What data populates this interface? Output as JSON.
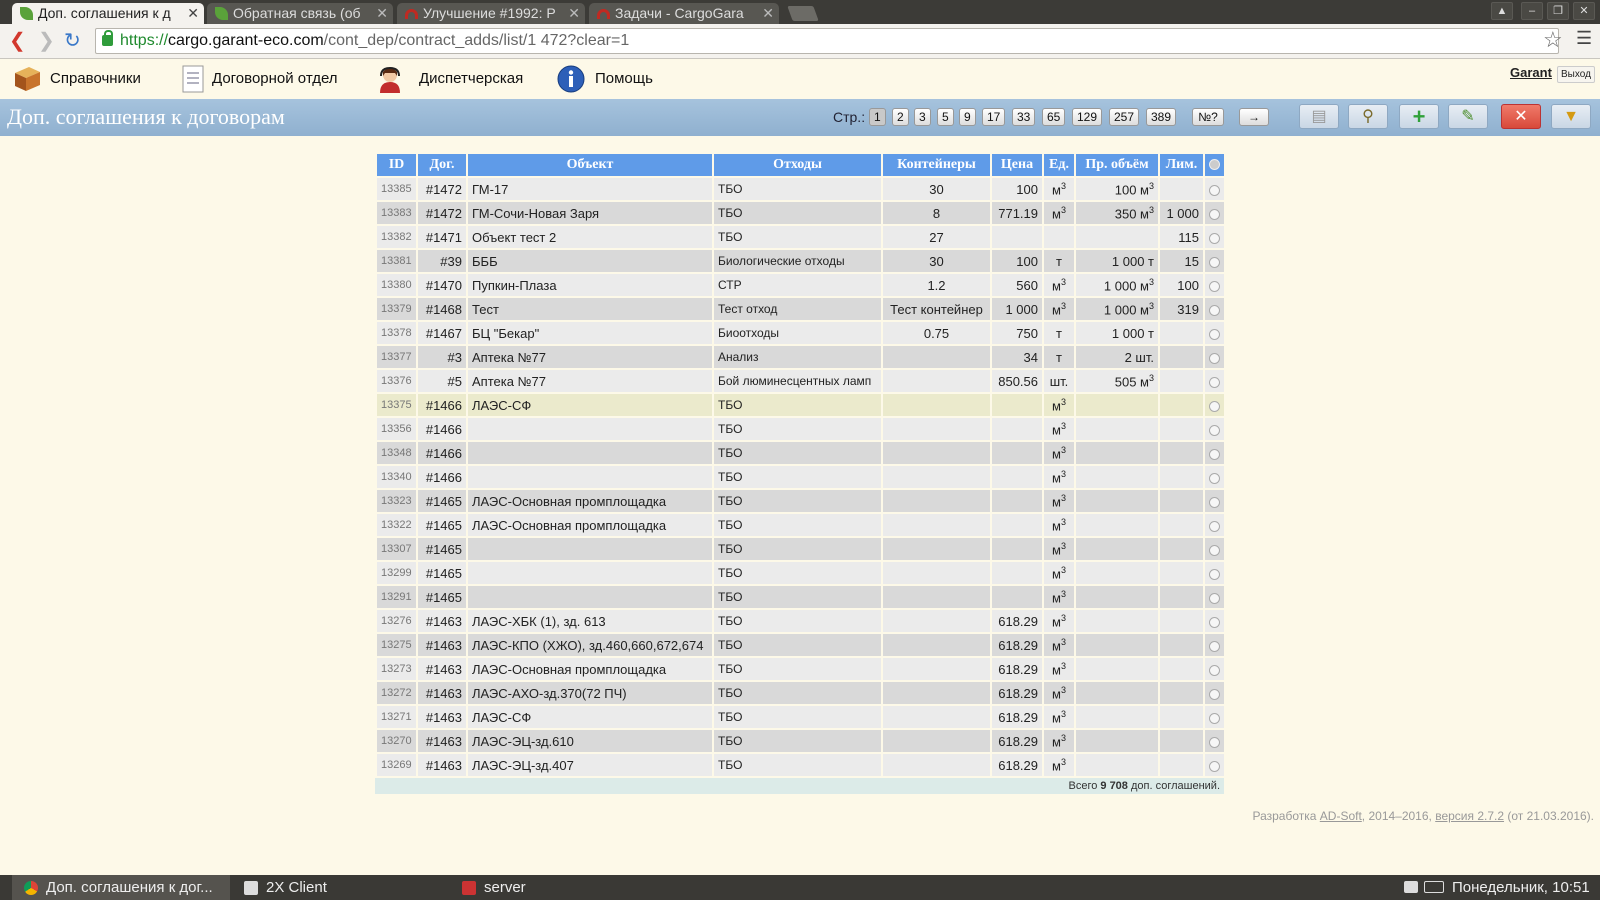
{
  "browser": {
    "tabs": [
      {
        "label": "Доп. соглашения к д",
        "icon": "leaf-icon"
      },
      {
        "label": "Обратная связь (об",
        "icon": "leaf-icon"
      },
      {
        "label": "Улучшение #1992: Р",
        "icon": "redmine-icon"
      },
      {
        "label": "Задачи - CargoGara",
        "icon": "redmine-icon"
      }
    ],
    "url_scheme": "https://",
    "url_host": "cargo.garant-eco.com",
    "url_path": "/cont_dep/contract_adds/list/1 472?clear=1"
  },
  "menu": {
    "items": [
      {
        "label": "Справочники",
        "icon": "book-icon"
      },
      {
        "label": "Договорной отдел",
        "icon": "document-icon"
      },
      {
        "label": "Диспетчерская",
        "icon": "operator-icon"
      },
      {
        "label": "Помощь",
        "icon": "info-icon"
      }
    ],
    "user": "Garant",
    "logout": "Выход"
  },
  "titlebar": {
    "title": "Доп. соглашения к договорам",
    "pages_label": "Стр.:",
    "pages": [
      "1",
      "2",
      "3",
      "5",
      "9",
      "17",
      "33",
      "65",
      "129",
      "257",
      "389",
      "№?",
      "→"
    ],
    "current_page": "1"
  },
  "colors": {
    "header_blue": "#5f9be8",
    "title_bar": "#9ab9d7",
    "page_bg": "#fdf9e8",
    "add_green": "#2fa13a",
    "delete_red": "#e2503e"
  },
  "table": {
    "columns": [
      "ID",
      "Дог.",
      "Объект",
      "Отходы",
      "Контейнеры",
      "Цена",
      "Ед.",
      "Пр. объём",
      "Лим."
    ],
    "rows": [
      {
        "id": "13385",
        "dog": "#1472",
        "obj": "ГМ-17",
        "waste": "ТБО",
        "cont": "30",
        "price": "100",
        "unit": "м",
        "unit_sup": "3",
        "vol": "100 м",
        "vol_sup": "3",
        "lim": ""
      },
      {
        "id": "13383",
        "dog": "#1472",
        "obj": "ГМ-Сочи-Новая Заря",
        "waste": "ТБО",
        "cont": "8",
        "price": "771.19",
        "unit": "м",
        "unit_sup": "3",
        "vol": "350 м",
        "vol_sup": "3",
        "lim": "1 000"
      },
      {
        "id": "13382",
        "dog": "#1471",
        "obj": "Объект тест 2",
        "waste": "ТБО",
        "cont": "27",
        "price": "",
        "unit": "",
        "unit_sup": "",
        "vol": "",
        "vol_sup": "",
        "lim": "115"
      },
      {
        "id": "13381",
        "dog": "#39",
        "obj": "БББ",
        "waste": "Биологические отходы",
        "cont": "30",
        "price": "100",
        "unit": "т",
        "unit_sup": "",
        "vol": "1 000 т",
        "vol_sup": "",
        "lim": "15"
      },
      {
        "id": "13380",
        "dog": "#1470",
        "obj": "Пупкин-Плаза",
        "waste": "СТР",
        "cont": "1.2",
        "price": "560",
        "unit": "м",
        "unit_sup": "3",
        "vol": "1 000 м",
        "vol_sup": "3",
        "lim": "100"
      },
      {
        "id": "13379",
        "dog": "#1468",
        "obj": "Тест",
        "waste": "Тест отход",
        "cont": "Тест контейнер",
        "price": "1 000",
        "unit": "м",
        "unit_sup": "3",
        "vol": "1 000 м",
        "vol_sup": "3",
        "lim": "319"
      },
      {
        "id": "13378",
        "dog": "#1467",
        "obj": "БЦ \"Бекар\"",
        "waste": "Биоотходы",
        "cont": "0.75",
        "price": "750",
        "unit": "т",
        "unit_sup": "",
        "vol": "1 000 т",
        "vol_sup": "",
        "lim": ""
      },
      {
        "id": "13377",
        "dog": "#3",
        "obj": "Аптека №77",
        "waste": "Анализ",
        "cont": "",
        "price": "34",
        "unit": "т",
        "unit_sup": "",
        "vol": "2 шт.",
        "vol_sup": "",
        "lim": ""
      },
      {
        "id": "13376",
        "dog": "#5",
        "obj": "Аптека №77",
        "waste": "Бой люминесцентных ламп",
        "cont": "",
        "price": "850.56",
        "unit": "шт.",
        "unit_sup": "",
        "vol": "505 м",
        "vol_sup": "3",
        "lim": ""
      },
      {
        "id": "13375",
        "dog": "#1466",
        "obj": "ЛАЭС-СФ",
        "waste": "ТБО",
        "cont": "",
        "price": "",
        "unit": "м",
        "unit_sup": "3",
        "vol": "",
        "vol_sup": "",
        "lim": ""
      },
      {
        "id": "13356",
        "dog": "#1466",
        "obj": "",
        "waste": "ТБО",
        "cont": "",
        "price": "",
        "unit": "м",
        "unit_sup": "3",
        "vol": "",
        "vol_sup": "",
        "lim": ""
      },
      {
        "id": "13348",
        "dog": "#1466",
        "obj": "",
        "waste": "ТБО",
        "cont": "",
        "price": "",
        "unit": "м",
        "unit_sup": "3",
        "vol": "",
        "vol_sup": "",
        "lim": ""
      },
      {
        "id": "13340",
        "dog": "#1466",
        "obj": "",
        "waste": "ТБО",
        "cont": "",
        "price": "",
        "unit": "м",
        "unit_sup": "3",
        "vol": "",
        "vol_sup": "",
        "lim": ""
      },
      {
        "id": "13323",
        "dog": "#1465",
        "obj": "ЛАЭС-Основная промплощадка",
        "waste": "ТБО",
        "cont": "",
        "price": "",
        "unit": "м",
        "unit_sup": "3",
        "vol": "",
        "vol_sup": "",
        "lim": ""
      },
      {
        "id": "13322",
        "dog": "#1465",
        "obj": "ЛАЭС-Основная промплощадка",
        "waste": "ТБО",
        "cont": "",
        "price": "",
        "unit": "м",
        "unit_sup": "3",
        "vol": "",
        "vol_sup": "",
        "lim": ""
      },
      {
        "id": "13307",
        "dog": "#1465",
        "obj": "",
        "waste": "ТБО",
        "cont": "",
        "price": "",
        "unit": "м",
        "unit_sup": "3",
        "vol": "",
        "vol_sup": "",
        "lim": ""
      },
      {
        "id": "13299",
        "dog": "#1465",
        "obj": "",
        "waste": "ТБО",
        "cont": "",
        "price": "",
        "unit": "м",
        "unit_sup": "3",
        "vol": "",
        "vol_sup": "",
        "lim": ""
      },
      {
        "id": "13291",
        "dog": "#1465",
        "obj": "",
        "waste": "ТБО",
        "cont": "",
        "price": "",
        "unit": "м",
        "unit_sup": "3",
        "vol": "",
        "vol_sup": "",
        "lim": ""
      },
      {
        "id": "13276",
        "dog": "#1463",
        "obj": "ЛАЭС-ХБК (1), зд. 613",
        "waste": "ТБО",
        "cont": "",
        "price": "618.29",
        "unit": "м",
        "unit_sup": "3",
        "vol": "",
        "vol_sup": "",
        "lim": ""
      },
      {
        "id": "13275",
        "dog": "#1463",
        "obj": "ЛАЭС-КПО (ХЖО), зд.460,660,672,674",
        "waste": "ТБО",
        "cont": "",
        "price": "618.29",
        "unit": "м",
        "unit_sup": "3",
        "vol": "",
        "vol_sup": "",
        "lim": ""
      },
      {
        "id": "13273",
        "dog": "#1463",
        "obj": "ЛАЭС-Основная промплощадка",
        "waste": "ТБО",
        "cont": "",
        "price": "618.29",
        "unit": "м",
        "unit_sup": "3",
        "vol": "",
        "vol_sup": "",
        "lim": ""
      },
      {
        "id": "13272",
        "dog": "#1463",
        "obj": "ЛАЭС-АХО-зд.370(72 ПЧ)",
        "waste": "ТБО",
        "cont": "",
        "price": "618.29",
        "unit": "м",
        "unit_sup": "3",
        "vol": "",
        "vol_sup": "",
        "lim": ""
      },
      {
        "id": "13271",
        "dog": "#1463",
        "obj": "ЛАЭС-СФ",
        "waste": "ТБО",
        "cont": "",
        "price": "618.29",
        "unit": "м",
        "unit_sup": "3",
        "vol": "",
        "vol_sup": "",
        "lim": ""
      },
      {
        "id": "13270",
        "dog": "#1463",
        "obj": "ЛАЭС-ЭЦ-зд.610",
        "waste": "ТБО",
        "cont": "",
        "price": "618.29",
        "unit": "м",
        "unit_sup": "3",
        "vol": "",
        "vol_sup": "",
        "lim": ""
      },
      {
        "id": "13269",
        "dog": "#1463",
        "obj": "ЛАЭС-ЭЦ-зд.407",
        "waste": "ТБО",
        "cont": "",
        "price": "618.29",
        "unit": "м",
        "unit_sup": "3",
        "vol": "",
        "vol_sup": "",
        "lim": ""
      }
    ],
    "highlighted_row": "13375",
    "total_prefix": "Всего",
    "total_count": "9 708",
    "total_suffix": "доп. соглашений."
  },
  "footer": {
    "prefix": "Разработка",
    "dev": "AD-Soft",
    "years": ", 2014–2016,",
    "version": "версия 2.7.2",
    "date": "(от 21.03.2016)."
  },
  "taskbar": {
    "items": [
      "Доп. соглашения к дог...",
      "2X Client",
      "server"
    ],
    "clock": "Понедельник, 10:51"
  }
}
